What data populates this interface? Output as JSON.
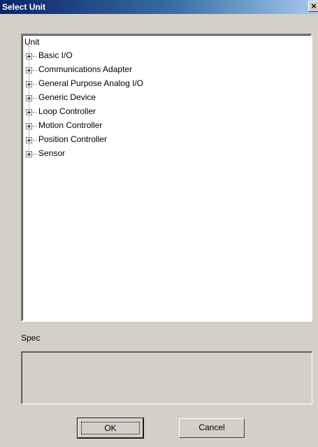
{
  "window": {
    "title": "Select Unit",
    "close_glyph": "×"
  },
  "tree": {
    "root_label": "Unit",
    "items": [
      {
        "label": "Basic I/O"
      },
      {
        "label": "Communications Adapter"
      },
      {
        "label": "General Purpose Analog I/O"
      },
      {
        "label": "Generic Device"
      },
      {
        "label": "Loop Controller"
      },
      {
        "label": "Motion Controller"
      },
      {
        "label": "Position Controller"
      },
      {
        "label": "Sensor"
      }
    ]
  },
  "spec": {
    "label": "Spec",
    "value": ""
  },
  "buttons": {
    "ok": "OK",
    "cancel": "Cancel"
  },
  "colors": {
    "title_bar_start": "#0a246a",
    "title_bar_end": "#a6caf0",
    "dialog_face": "#d4d0c8"
  }
}
